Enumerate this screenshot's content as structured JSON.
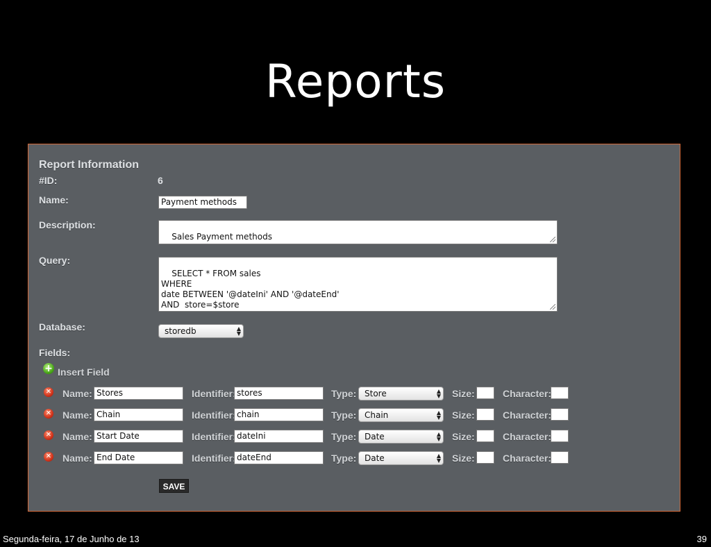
{
  "slide": {
    "title": "Reports",
    "footer_date": "Segunda-feira, 17 de Junho de 13",
    "page_number": "39"
  },
  "form": {
    "section_title": "Report Information",
    "id_label": "#ID:",
    "id_value": "6",
    "name_label": "Name:",
    "name_value": "Payment methods",
    "description_label": "Description:",
    "description_value": "Sales Payment methods",
    "query_label": "Query:",
    "query_value": "SELECT * FROM sales\nWHERE\ndate BETWEEN '@dateIni' AND '@dateEnd'\nAND  store=$store",
    "database_label": "Database:",
    "database_value": "storedb",
    "fields_label": "Fields:",
    "insert_field_label": "Insert Field",
    "save_label": "SAVE"
  },
  "field_labels": {
    "name": "Name:",
    "identifier": "Identifier:",
    "type": "Type:",
    "size": "Size:",
    "character": "Character:"
  },
  "fields": [
    {
      "name": "Stores",
      "identifier": "stores",
      "type": "Store",
      "size": "",
      "character": ""
    },
    {
      "name": "Chain",
      "identifier": "chain",
      "type": "Chain",
      "size": "",
      "character": ""
    },
    {
      "name": "Start Date",
      "identifier": "dateIni",
      "type": "Date",
      "size": "",
      "character": ""
    },
    {
      "name": "End Date",
      "identifier": "dateEnd",
      "type": "Date",
      "size": "",
      "character": ""
    }
  ],
  "icons": {
    "delete": "delete-icon",
    "add": "add-icon"
  },
  "colors": {
    "panel_background": "#5a5e62",
    "panel_border": "#d46a3a",
    "delete_icon": "#d0321a",
    "add_icon": "#4aa81a"
  }
}
